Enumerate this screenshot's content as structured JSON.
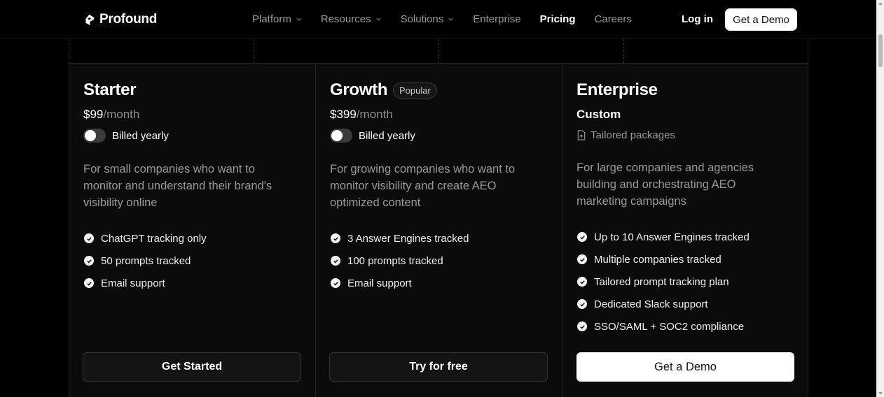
{
  "brand": {
    "name": "Profound"
  },
  "nav": {
    "items": [
      {
        "label": "Platform",
        "dropdown": true
      },
      {
        "label": "Resources",
        "dropdown": true
      },
      {
        "label": "Solutions",
        "dropdown": true
      },
      {
        "label": "Enterprise",
        "dropdown": false
      },
      {
        "label": "Pricing",
        "dropdown": false,
        "active": true
      },
      {
        "label": "Careers",
        "dropdown": false
      }
    ],
    "login": "Log in",
    "demo": "Get a Demo"
  },
  "plans": [
    {
      "name": "Starter",
      "price": "$99",
      "period": "/month",
      "toggle_label": "Billed yearly",
      "toggle_on": false,
      "description": "For small companies who want to monitor and understand their brand's visibility online",
      "features": [
        "ChatGPT tracking only",
        "50 prompts tracked",
        "Email support"
      ],
      "cta": "Get Started"
    },
    {
      "name": "Growth",
      "badge": "Popular",
      "price": "$399",
      "period": "/month",
      "toggle_label": "Billed yearly",
      "toggle_on": false,
      "description": "For growing companies who want to monitor visibility and create AEO optimized content",
      "features": [
        "3 Answer Engines tracked",
        "100 prompts tracked",
        "Email support"
      ],
      "cta": "Try for free"
    },
    {
      "name": "Enterprise",
      "price": "Custom",
      "subnote": "Tailored packages",
      "description": "For large companies and agencies building and orchestrating AEO marketing campaigns",
      "features": [
        "Up to 10 Answer Engines tracked",
        "Multiple companies tracked",
        "Tailored prompt tracking plan",
        "Dedicated Slack support",
        "SSO/SAML + SOC2 compliance"
      ],
      "cta": "Get a Demo"
    }
  ]
}
